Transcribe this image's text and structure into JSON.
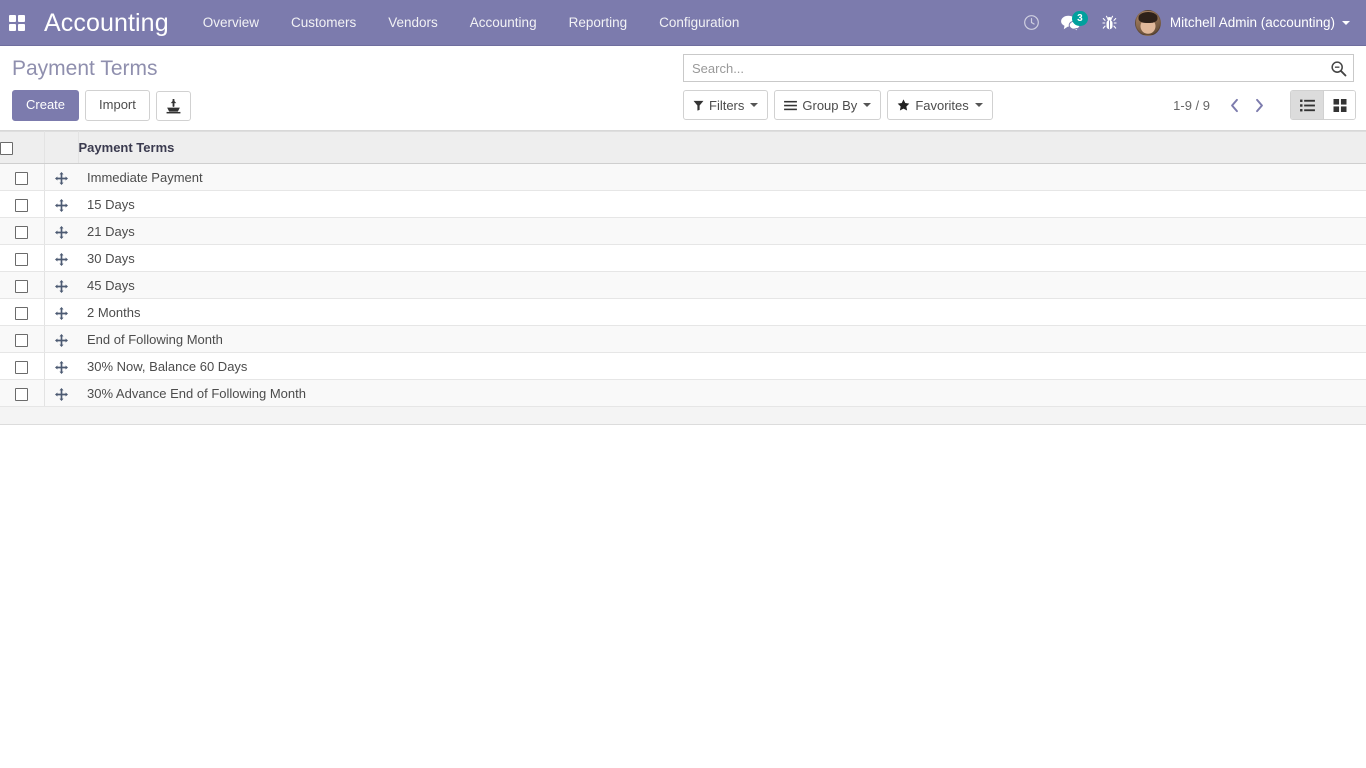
{
  "navbar": {
    "apps_icon": "apps-grid-icon",
    "brand": "Accounting",
    "menu_items": [
      {
        "label": "Overview"
      },
      {
        "label": "Customers"
      },
      {
        "label": "Vendors"
      },
      {
        "label": "Accounting"
      },
      {
        "label": "Reporting"
      },
      {
        "label": "Configuration"
      }
    ],
    "activity_icon": "clock-icon",
    "messages_icon": "chat-bubbles-icon",
    "messages_badge": "3",
    "debug_icon": "bug-icon",
    "avatar_icon": "user-avatar",
    "user_name": "Mitchell Admin (accounting)",
    "user_caret_icon": "caret-down-icon",
    "colors": {
      "navbar_bg": "#7C7BAD",
      "badge_bg": "#00A09D",
      "primary": "#7C7BAD"
    }
  },
  "control_panel": {
    "title": "Payment Terms",
    "create_label": "Create",
    "import_label": "Import",
    "export_icon": "upload-tray-icon",
    "search": {
      "placeholder": "Search...",
      "value": "",
      "icon": "search-magnifier-icon"
    },
    "filters": {
      "label": "Filters",
      "icon": "funnel-icon",
      "caret": "caret-down-icon"
    },
    "group_by": {
      "label": "Group By",
      "icon": "hamburger-lines-icon",
      "caret": "caret-down-icon"
    },
    "favorites": {
      "label": "Favorites",
      "icon": "star-icon",
      "caret": "caret-down-icon"
    },
    "pager": {
      "range": "1-9 / 9",
      "prev_icon": "chevron-left-icon",
      "next_icon": "chevron-right-icon"
    },
    "view_switcher": {
      "list_icon": "list-view-icon",
      "kanban_icon": "kanban-view-icon",
      "active": "list"
    }
  },
  "list": {
    "select_all_icon": "checkbox-unchecked",
    "columns": [
      "Payment Terms"
    ],
    "rows": [
      {
        "name": "Immediate Payment"
      },
      {
        "name": "15 Days"
      },
      {
        "name": "21 Days"
      },
      {
        "name": "30 Days"
      },
      {
        "name": "45 Days"
      },
      {
        "name": "2 Months"
      },
      {
        "name": "End of Following Month"
      },
      {
        "name": "30% Now, Balance 60 Days"
      },
      {
        "name": "30% Advance End of Following Month"
      }
    ]
  }
}
